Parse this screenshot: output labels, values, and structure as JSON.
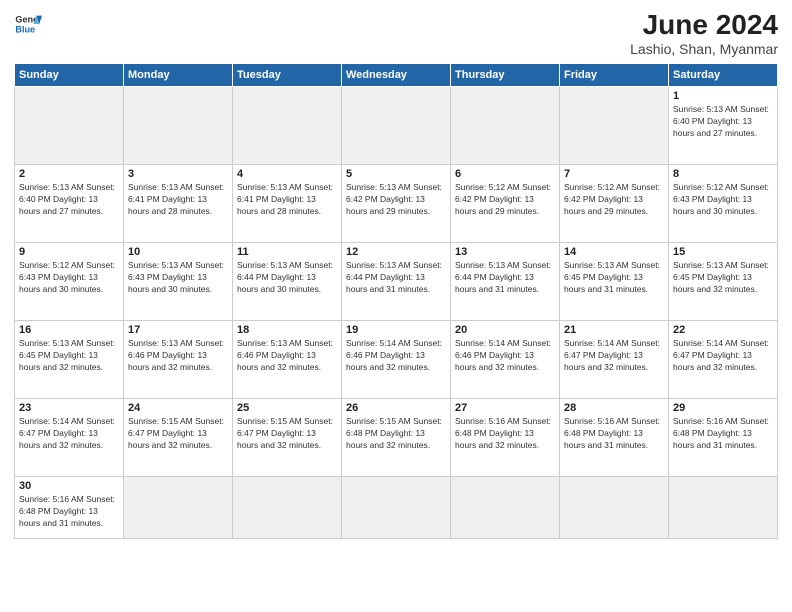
{
  "logo": {
    "line1": "General",
    "line2": "Blue"
  },
  "header": {
    "month": "June 2024",
    "location": "Lashio, Shan, Myanmar"
  },
  "weekdays": [
    "Sunday",
    "Monday",
    "Tuesday",
    "Wednesday",
    "Thursday",
    "Friday",
    "Saturday"
  ],
  "days": [
    {
      "num": "",
      "info": "",
      "empty": true
    },
    {
      "num": "",
      "info": "",
      "empty": true
    },
    {
      "num": "",
      "info": "",
      "empty": true
    },
    {
      "num": "",
      "info": "",
      "empty": true
    },
    {
      "num": "",
      "info": "",
      "empty": true
    },
    {
      "num": "",
      "info": "",
      "empty": true
    },
    {
      "num": "1",
      "info": "Sunrise: 5:13 AM\nSunset: 6:40 PM\nDaylight: 13 hours\nand 27 minutes."
    }
  ],
  "week2": [
    {
      "num": "2",
      "info": "Sunrise: 5:13 AM\nSunset: 6:40 PM\nDaylight: 13 hours\nand 27 minutes."
    },
    {
      "num": "3",
      "info": "Sunrise: 5:13 AM\nSunset: 6:41 PM\nDaylight: 13 hours\nand 28 minutes."
    },
    {
      "num": "4",
      "info": "Sunrise: 5:13 AM\nSunset: 6:41 PM\nDaylight: 13 hours\nand 28 minutes."
    },
    {
      "num": "5",
      "info": "Sunrise: 5:13 AM\nSunset: 6:42 PM\nDaylight: 13 hours\nand 29 minutes."
    },
    {
      "num": "6",
      "info": "Sunrise: 5:12 AM\nSunset: 6:42 PM\nDaylight: 13 hours\nand 29 minutes."
    },
    {
      "num": "7",
      "info": "Sunrise: 5:12 AM\nSunset: 6:42 PM\nDaylight: 13 hours\nand 29 minutes."
    },
    {
      "num": "8",
      "info": "Sunrise: 5:12 AM\nSunset: 6:43 PM\nDaylight: 13 hours\nand 30 minutes."
    }
  ],
  "week3": [
    {
      "num": "9",
      "info": "Sunrise: 5:12 AM\nSunset: 6:43 PM\nDaylight: 13 hours\nand 30 minutes."
    },
    {
      "num": "10",
      "info": "Sunrise: 5:13 AM\nSunset: 6:43 PM\nDaylight: 13 hours\nand 30 minutes."
    },
    {
      "num": "11",
      "info": "Sunrise: 5:13 AM\nSunset: 6:44 PM\nDaylight: 13 hours\nand 30 minutes."
    },
    {
      "num": "12",
      "info": "Sunrise: 5:13 AM\nSunset: 6:44 PM\nDaylight: 13 hours\nand 31 minutes."
    },
    {
      "num": "13",
      "info": "Sunrise: 5:13 AM\nSunset: 6:44 PM\nDaylight: 13 hours\nand 31 minutes."
    },
    {
      "num": "14",
      "info": "Sunrise: 5:13 AM\nSunset: 6:45 PM\nDaylight: 13 hours\nand 31 minutes."
    },
    {
      "num": "15",
      "info": "Sunrise: 5:13 AM\nSunset: 6:45 PM\nDaylight: 13 hours\nand 32 minutes."
    }
  ],
  "week4": [
    {
      "num": "16",
      "info": "Sunrise: 5:13 AM\nSunset: 6:45 PM\nDaylight: 13 hours\nand 32 minutes."
    },
    {
      "num": "17",
      "info": "Sunrise: 5:13 AM\nSunset: 6:46 PM\nDaylight: 13 hours\nand 32 minutes."
    },
    {
      "num": "18",
      "info": "Sunrise: 5:13 AM\nSunset: 6:46 PM\nDaylight: 13 hours\nand 32 minutes."
    },
    {
      "num": "19",
      "info": "Sunrise: 5:14 AM\nSunset: 6:46 PM\nDaylight: 13 hours\nand 32 minutes."
    },
    {
      "num": "20",
      "info": "Sunrise: 5:14 AM\nSunset: 6:46 PM\nDaylight: 13 hours\nand 32 minutes."
    },
    {
      "num": "21",
      "info": "Sunrise: 5:14 AM\nSunset: 6:47 PM\nDaylight: 13 hours\nand 32 minutes."
    },
    {
      "num": "22",
      "info": "Sunrise: 5:14 AM\nSunset: 6:47 PM\nDaylight: 13 hours\nand 32 minutes."
    }
  ],
  "week5": [
    {
      "num": "23",
      "info": "Sunrise: 5:14 AM\nSunset: 6:47 PM\nDaylight: 13 hours\nand 32 minutes."
    },
    {
      "num": "24",
      "info": "Sunrise: 5:15 AM\nSunset: 6:47 PM\nDaylight: 13 hours\nand 32 minutes."
    },
    {
      "num": "25",
      "info": "Sunrise: 5:15 AM\nSunset: 6:47 PM\nDaylight: 13 hours\nand 32 minutes."
    },
    {
      "num": "26",
      "info": "Sunrise: 5:15 AM\nSunset: 6:48 PM\nDaylight: 13 hours\nand 32 minutes."
    },
    {
      "num": "27",
      "info": "Sunrise: 5:16 AM\nSunset: 6:48 PM\nDaylight: 13 hours\nand 32 minutes."
    },
    {
      "num": "28",
      "info": "Sunrise: 5:16 AM\nSunset: 6:48 PM\nDaylight: 13 hours\nand 31 minutes."
    },
    {
      "num": "29",
      "info": "Sunrise: 5:16 AM\nSunset: 6:48 PM\nDaylight: 13 hours\nand 31 minutes."
    }
  ],
  "week6": [
    {
      "num": "30",
      "info": "Sunrise: 5:16 AM\nSunset: 6:48 PM\nDaylight: 13 hours\nand 31 minutes."
    },
    {
      "num": "",
      "info": "",
      "empty": true
    },
    {
      "num": "",
      "info": "",
      "empty": true
    },
    {
      "num": "",
      "info": "",
      "empty": true
    },
    {
      "num": "",
      "info": "",
      "empty": true
    },
    {
      "num": "",
      "info": "",
      "empty": true
    },
    {
      "num": "",
      "info": "",
      "empty": true
    }
  ]
}
